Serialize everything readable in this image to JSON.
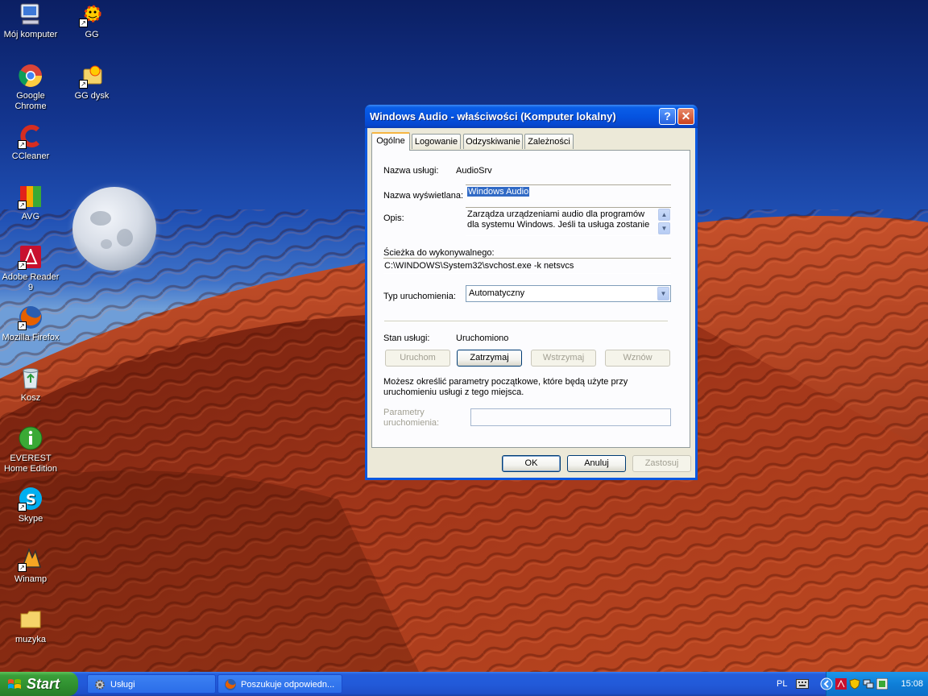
{
  "desktop": {
    "icons": [
      {
        "label": "Mój komputer",
        "icon": "my-computer-icon"
      },
      {
        "label": "GG",
        "icon": "gg-sun-icon"
      },
      {
        "label": "Google Chrome",
        "icon": "chrome-icon"
      },
      {
        "label": "GG dysk",
        "icon": "gg-disk-icon"
      },
      {
        "label": "CCleaner",
        "icon": "ccleaner-icon"
      },
      {
        "label": "AVG",
        "icon": "avg-icon"
      },
      {
        "label": "Adobe Reader 9",
        "icon": "adobe-reader-icon"
      },
      {
        "label": "Mozilla Firefox",
        "icon": "firefox-icon"
      },
      {
        "label": "Kosz",
        "icon": "recycle-bin-icon"
      },
      {
        "label": "EVEREST Home Edition",
        "icon": "everest-icon"
      },
      {
        "label": "Skype",
        "icon": "skype-icon"
      },
      {
        "label": "Winamp",
        "icon": "winamp-icon"
      },
      {
        "label": "muzyka",
        "icon": "folder-icon"
      }
    ]
  },
  "dialog": {
    "title": "Windows Audio - właściwości (Komputer lokalny)",
    "help_label": "?",
    "close_label": "✕",
    "tabs": [
      {
        "label": "Ogólne",
        "active": true
      },
      {
        "label": "Logowanie",
        "active": false
      },
      {
        "label": "Odzyskiwanie",
        "active": false
      },
      {
        "label": "Zależności",
        "active": false
      }
    ],
    "service_name_label": "Nazwa usługi:",
    "service_name_value": "AudioSrv",
    "display_name_label": "Nazwa wyświetlana:",
    "display_name_value": "Windows Audio",
    "description_label": "Opis:",
    "description_value": "Zarządza urządzeniami audio dla programów dla systemu Windows. Jeśli ta usługa zostanie",
    "path_label": "Ścieżka do wykonywalnego:",
    "path_value": "C:\\WINDOWS\\System32\\svchost.exe -k netsvcs",
    "startup_type_label": "Typ uruchomienia:",
    "startup_type_value": "Automatyczny",
    "status_label": "Stan usługi:",
    "status_value": "Uruchomiono",
    "buttons": {
      "start": "Uruchom",
      "stop": "Zatrzymaj",
      "pause": "Wstrzymaj",
      "resume": "Wznów"
    },
    "hint": "Możesz określić parametry początkowe, które będą użyte przy uruchomieniu usługi z tego miejsca.",
    "params_label": "Parametry uruchomienia:",
    "params_value": "",
    "ok": "OK",
    "cancel": "Anuluj",
    "apply": "Zastosuj"
  },
  "taskbar": {
    "start_label": "Start",
    "tasks": [
      {
        "label": "Usługi",
        "icon": "services-gear-icon"
      },
      {
        "label": "Poszukuje odpowiedn...",
        "icon": "firefox-icon"
      }
    ],
    "language": "PL",
    "clock": "15:08"
  },
  "colors": {
    "xp_blue": "#0a58e0",
    "taskbar_blue": "#245ddb",
    "start_green": "#3a9f3a",
    "dialog_face": "#ece9d8"
  }
}
